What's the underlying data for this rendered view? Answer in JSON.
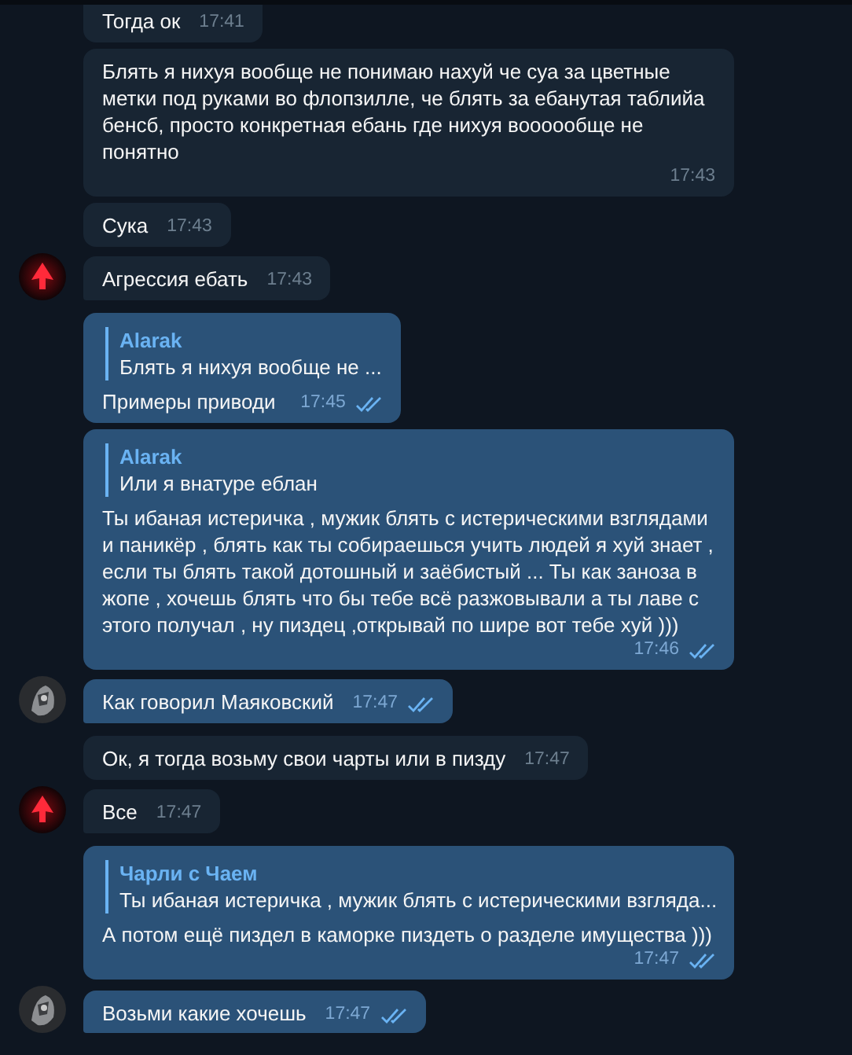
{
  "messages": [
    {
      "kind": "incoming",
      "text": "Тогда ок",
      "time": "17:41",
      "avatar": false
    },
    {
      "kind": "incoming",
      "text": "Блять я нихуя вообще не понимаю нахуй че суа за цветные метки под руками во флопзилле, че блять за ебанутая таблийа бенсб, просто конкретная ебань где нихуя воооообще не понятно",
      "time": "17:43",
      "avatar": false
    },
    {
      "kind": "incoming",
      "text": "Сука",
      "time": "17:43",
      "avatar": false
    },
    {
      "kind": "incoming",
      "text": "Агрессия ебать",
      "time": "17:43",
      "avatar": true
    },
    {
      "kind": "outgoing",
      "reply": {
        "author": "Alarak",
        "text": "Блять я нихуя вообще не ..."
      },
      "text": "Примеры приводи",
      "time": "17:45",
      "read": true,
      "avatar": false
    },
    {
      "kind": "outgoing",
      "reply": {
        "author": "Alarak",
        "text": "Или я внатуре еблан"
      },
      "text": "Ты ибаная истеричка , мужик блять с истерическими взглядами и паникёр , блять как ты собираешься учить людей я хуй знает , если ты блять такой дотошный и заёбистый ... Ты как заноза в жопе , хочешь блять что бы тебе всё разжовывали а ты лаве с этого получал , ну пиздец ,открывай по шире вот тебе хуй )))",
      "time": "17:46",
      "read": true,
      "avatar": false
    },
    {
      "kind": "outgoing",
      "text": "Как говорил Маяковский",
      "time": "17:47",
      "read": true,
      "avatar": true
    },
    {
      "kind": "incoming",
      "text": "Ок, я тогда возьму свои чарты или в пизду",
      "time": "17:47",
      "avatar": false
    },
    {
      "kind": "incoming",
      "text": "Все",
      "time": "17:47",
      "avatar": true
    },
    {
      "kind": "outgoing",
      "reply": {
        "author": "Чарли с Чаем",
        "text": "Ты ибаная истеричка , мужик блять с истерическими взгляда..."
      },
      "text": "А потом ещё пиздел в каморке пиздеть о разделе имущества )))",
      "time": "17:47",
      "read": true,
      "avatar": false
    },
    {
      "kind": "outgoing",
      "text": "Возьми какие хочешь",
      "time": "17:47",
      "read": true,
      "avatar": true
    }
  ]
}
